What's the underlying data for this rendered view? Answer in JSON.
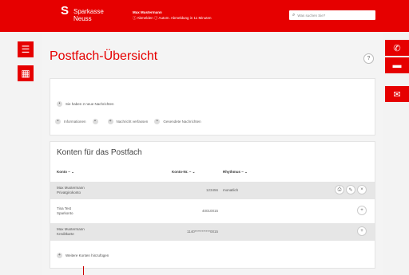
{
  "header": {
    "brand_mark": "S",
    "brand_line1": "Sparkasse",
    "brand_line2": "Neuss",
    "user_name": "Max Mustermann",
    "user_status": "ⓘ Abmelden ⓘ Autom. Abmeldung in 11 Minuten",
    "search_placeholder": "Was suchen Sie?",
    "search_icon": "search-icon"
  },
  "left_rail": {
    "menu_icon": "menu-icon",
    "grid_icon": "grid-icon"
  },
  "right_rail": {
    "phone_icon": "phone-icon",
    "chat_icon": "chat-icon",
    "mail_icon": "mail-icon"
  },
  "page": {
    "title": "Postfach-Übersicht",
    "help": "?"
  },
  "messages": {
    "new_info": "Sie haben 2 neue Nachrichten",
    "filters": [
      {
        "label": "Informationen"
      },
      {
        "label": ""
      },
      {
        "label": "Nachricht verfassen"
      },
      {
        "label": "Gesendete Nachrichten"
      }
    ]
  },
  "accounts": {
    "title": "Konten für das Postfach",
    "columns": {
      "konto": "Konto",
      "kontonr": "Konto-Nr.",
      "rhythmus": "Rhythmus"
    },
    "rows": [
      {
        "name1": "Max Mustermann",
        "name2": "Privatgirokonto",
        "number": "123456",
        "rhythm": "monatlich",
        "shaded": true
      },
      {
        "name1": "Tina Test",
        "name2": "Sparkonto",
        "number": "40010015",
        "rhythm": "",
        "shaded": false
      },
      {
        "name1": "Max Mustermann",
        "name2": "Kreditkarte",
        "number": "1140***********0015",
        "rhythm": "",
        "shaded": true
      }
    ],
    "more": "Weitere Konten hinzufügen"
  }
}
